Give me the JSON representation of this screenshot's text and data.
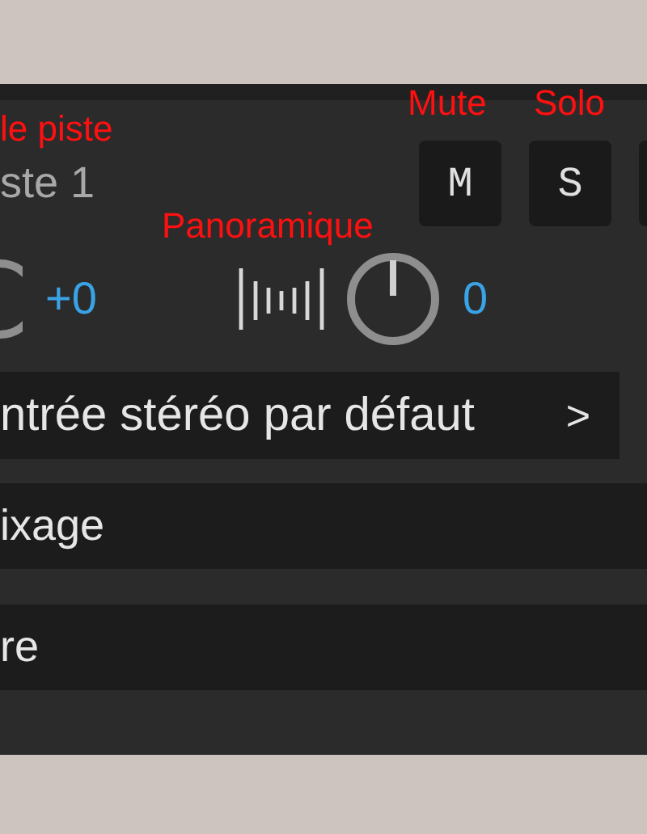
{
  "annotations": [
    {
      "text": "le piste"
    },
    {
      "text": "Mute"
    },
    {
      "text": "Solo"
    },
    {
      "text": "Panoramique"
    }
  ],
  "track": {
    "name": "ste 1"
  },
  "buttons": [
    {
      "label": "M"
    },
    {
      "label": "S"
    }
  ],
  "volume": {
    "value": "+0"
  },
  "pan": {
    "value": "0"
  },
  "input": {
    "value": "ntrée stéréo par défaut",
    "chevron": ">"
  },
  "sections": [
    {
      "label": "ixage"
    },
    {
      "label": "re"
    }
  ]
}
